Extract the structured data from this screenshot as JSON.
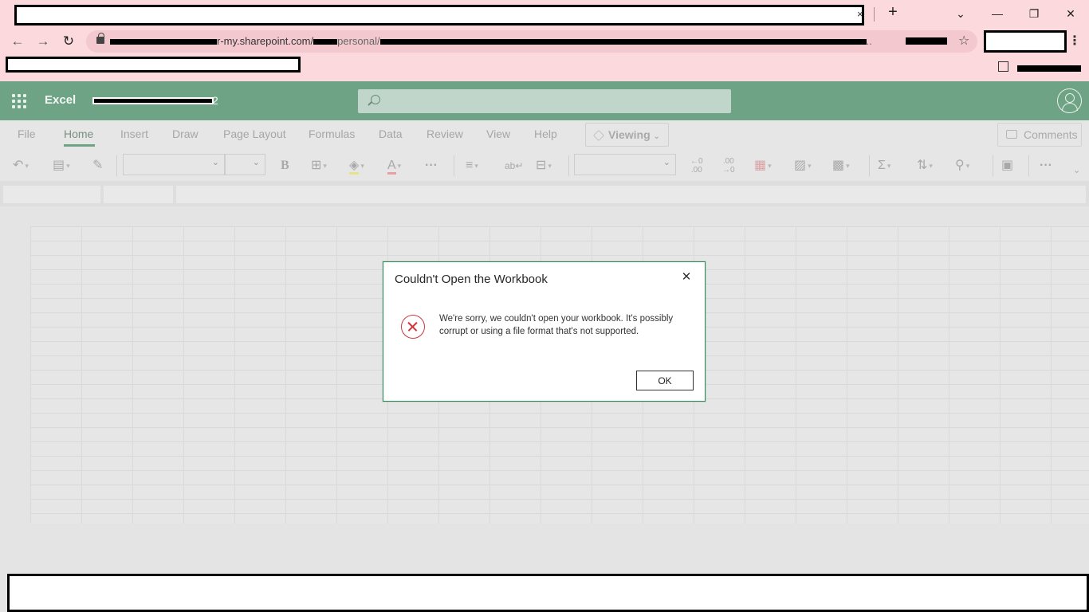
{
  "browser": {
    "tab_close": "×",
    "new_tab": "+",
    "window_controls": {
      "tab_search": "⌄",
      "minimize": "—",
      "restore": "❐",
      "close": "✕"
    },
    "nav": {
      "back": "←",
      "forward": "→",
      "reload": "↻"
    },
    "url_visible": "r-my.sharepoint.com/",
    "url_path": "personal/",
    "url_ellipsis": "..",
    "bookmark_star": "☆",
    "menu": "⋮"
  },
  "excel": {
    "app_name": "Excel",
    "doc_name_suffix": "2",
    "search": {
      "placeholder": ""
    },
    "ribbon_tabs": [
      "File",
      "Home",
      "Insert",
      "Draw",
      "Page Layout",
      "Formulas",
      "Data",
      "Review",
      "View",
      "Help"
    ],
    "active_tab": "Home",
    "viewing_label": "Viewing",
    "comments_label": "Comments"
  },
  "toolbar_icons": [
    "undo-icon",
    "paste-icon",
    "format-painter-icon",
    "bold-icon",
    "borders-icon",
    "fill-color-icon",
    "font-color-icon",
    "more-icon",
    "align-icon",
    "wrap-text-icon",
    "merge-icon",
    "increase-decimal-icon",
    "decrease-decimal-icon",
    "conditional-format-icon",
    "format-table-icon",
    "cell-styles-icon",
    "autosum-icon",
    "sort-filter-icon",
    "find-icon",
    "addins-icon",
    "more-options-icon"
  ],
  "dialog": {
    "title": "Couldn't Open the Workbook",
    "message": "We're sorry, we couldn't open your workbook. It's possibly corrupt or using a file format that's not supported.",
    "ok_label": "OK",
    "close_glyph": "✕"
  },
  "accent": {
    "excel_green": "#6ea386",
    "error_red": "#d13438",
    "browser_pink": "#fcd9dd"
  }
}
